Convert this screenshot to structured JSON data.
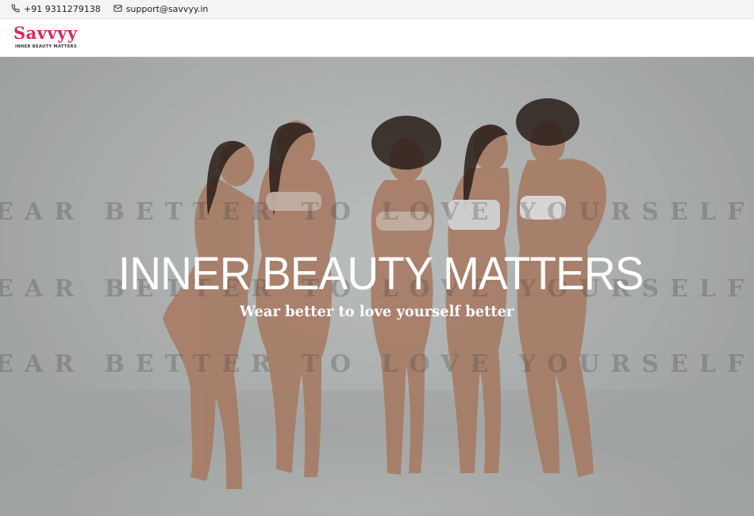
{
  "topbar": {
    "phone": "+91 9311279138",
    "email": "support@savvyy.in",
    "icons": {
      "phone": "phone-icon",
      "email": "mail-icon"
    }
  },
  "header": {
    "logo_text": "Savvyy",
    "logo_tagline": "INNER BEAUTY MATTERS",
    "brand_color": "#e0265a"
  },
  "hero": {
    "title": "INNER BEAUTY MATTERS",
    "subtitle": "Wear better to love yourself better",
    "watermark_lines": [
      "EAR BETTER TO LOVE YOURSELF BET",
      "EAR BETTER TO LOVE YOURSELF BET",
      "EAR BETTER TO LOVE YOURSELF BET"
    ]
  }
}
